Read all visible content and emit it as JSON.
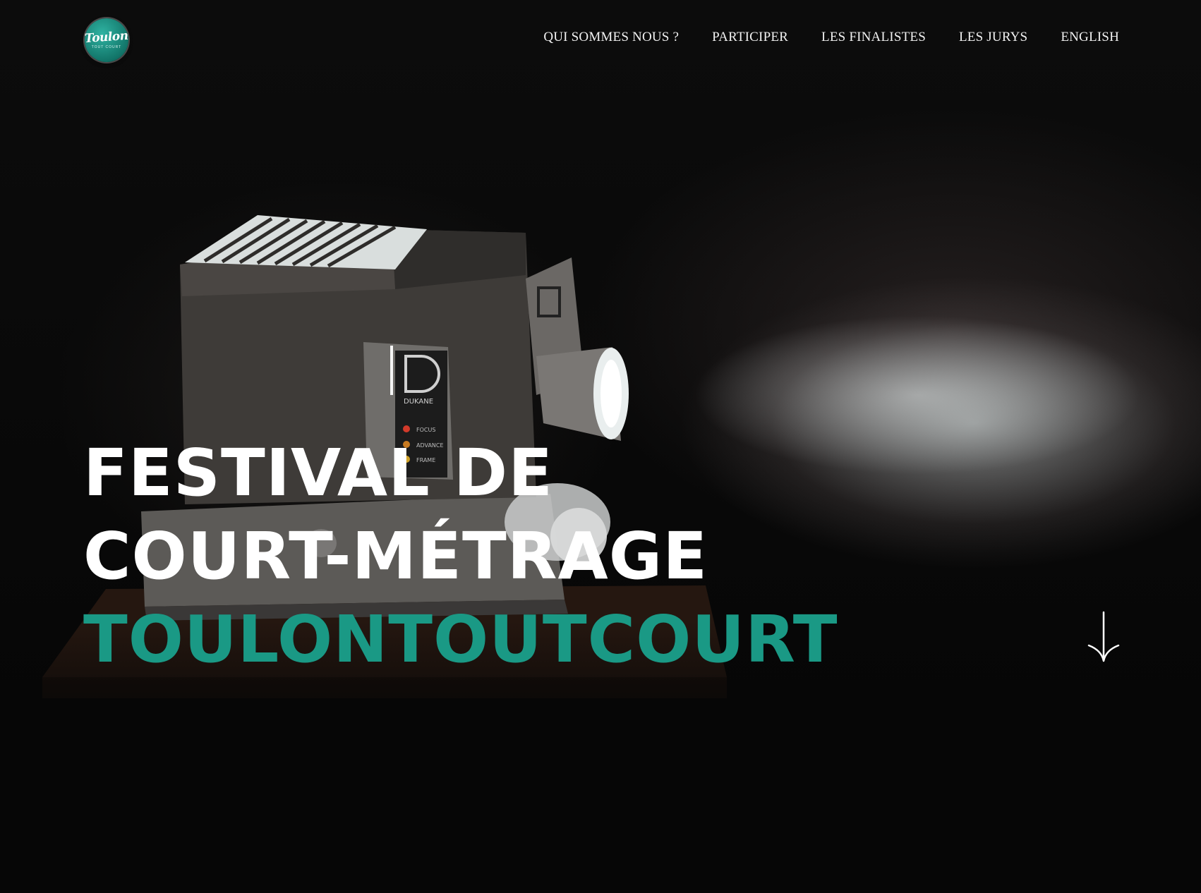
{
  "site": {
    "logo_label": "Toulon",
    "logo_sublabel": "TOUT COURT",
    "accent_color": "#1a9985"
  },
  "nav": {
    "items": [
      {
        "label": "QUI SOMMES NOUS ?"
      },
      {
        "label": "PARTICIPER"
      },
      {
        "label": "LES FINALISTES"
      },
      {
        "label": "LES JURYS"
      },
      {
        "label": "ENGLISH"
      }
    ]
  },
  "hero": {
    "title_line_1": "FESTIVAL DE",
    "title_line_2": "COURT-MÉTRAGE",
    "title_line_3": "TOULONTOUTCOURT",
    "scroll_icon": "arrow-down-icon",
    "projector_labels": {
      "brand": "DUKANE",
      "focus": "FOCUS",
      "advance": "ADVANCE",
      "frame": "FRAME"
    }
  }
}
